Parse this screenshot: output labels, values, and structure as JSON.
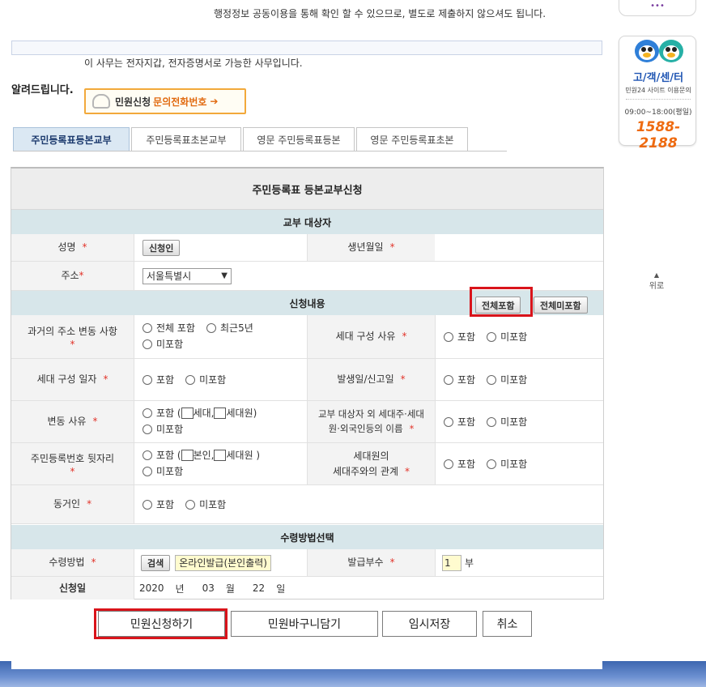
{
  "notices": {
    "top_line": "행정정보 공동이용을 통해 확인 할 수 있으므로, 별도로 제출하지 않으셔도 됩니다.",
    "info_line": "이 사무는 전자지갑, 전자증명서로 가능한 사무입니다.",
    "notice_label": "알려드립니다.",
    "call_button_prefix": "민원신청",
    "call_button_main": "문의전화번호",
    "call_button_arrow": "➔"
  },
  "tabs": [
    {
      "label": "주민등록표등본교부",
      "active": true
    },
    {
      "label": "주민등록표초본교부",
      "active": false
    },
    {
      "label": "영문 주민등록표등본",
      "active": false
    },
    {
      "label": "영문 주민등록표초본",
      "active": false
    }
  ],
  "form": {
    "title": "주민등록표 등본교부신청",
    "target_section": {
      "header": "교부 대상자",
      "name_label": "성명",
      "applicant_button": "신청인",
      "birth_label": "생년월일",
      "address_label": "주소",
      "address_selected": "서울특별시",
      "required_mark": "*"
    },
    "content_section": {
      "header": "신청내용",
      "include_all_button": "전체포함",
      "exclude_all_button": "전체미포함",
      "past_address_label": "과거의 주소 변동 사항",
      "past_address_opt1": "전체 포함",
      "past_address_opt2": "최근5년",
      "past_address_opt3": "미포함",
      "household_reason_label": "세대 구성 사유",
      "household_date_label": "세대 구성 일자",
      "occur_date_label": "발생일/신고일",
      "change_reason_label": "변동 사유",
      "change_reason_include_prefix": "포함 (",
      "change_reason_chk1": "세대,",
      "change_reason_chk2": "세대원)",
      "other_names_label_1": "교부 대상자 외 세대주·세대",
      "other_names_label_2": "원·외국인등의 이름",
      "rrn_label": "주민등록번호 뒷자리",
      "rrn_include_prefix": "포함 (",
      "rrn_chk1": "본인,",
      "rrn_chk2": "세대원 )",
      "relation_label_1": "세대원의",
      "relation_label_2": "세대주와의 관계",
      "cohabitant_label": "동거인",
      "include": "포함",
      "exclude": "미포함"
    },
    "receipt_section": {
      "header": "수령방법선택",
      "method_label": "수령방법",
      "search_button": "검색",
      "method_value": "온라인발급(본인출력)",
      "copies_label": "발급부수",
      "copies_value": "1",
      "copies_unit": "부",
      "date_label": "신청일",
      "year": "2020",
      "year_unit": "년",
      "month": "03",
      "month_unit": "월",
      "day": "22",
      "day_unit": "일"
    }
  },
  "actions": {
    "submit": "민원신청하기",
    "basket": "민원바구니담기",
    "temp_save": "임시저장",
    "cancel": "취소"
  },
  "sidebar": {
    "top_pill": "•••",
    "cs_title": "고/객/센/터",
    "cs_sub": "민원24 사이트 이용문의",
    "cs_hours": "09:00~18:00(평일)",
    "cs_phone": "1588-2188",
    "to_top_arrow": "▲",
    "to_top": "위로"
  },
  "colors": {
    "highlight_red": "#d9141b",
    "section_teal": "#d7e6ea",
    "accent_orange": "#e16a10",
    "cs_blue": "#1f55b3"
  }
}
